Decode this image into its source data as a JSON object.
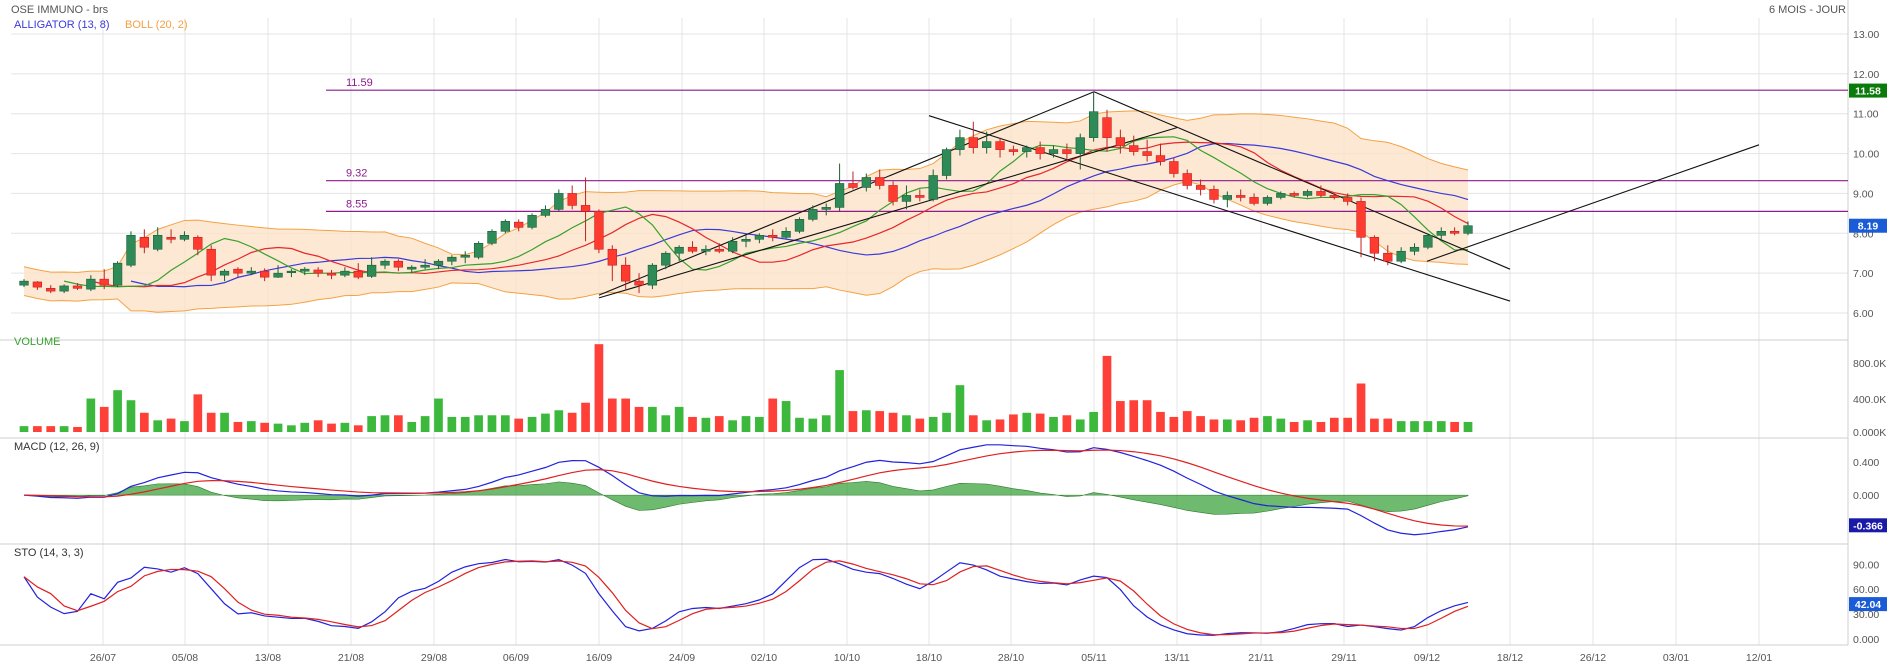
{
  "header": {
    "title": "OSE IMMUNO - brs",
    "period": "6 MOIS - JOUR",
    "legend_alligator": "ALLIGATOR (13, 8)",
    "legend_boll": "BOLL (20, 2)",
    "volume_label": "VOLUME",
    "macd_label": "MACD (12, 26, 9)",
    "sto_label": "STO (14, 3, 3)"
  },
  "colors": {
    "up": "#2e8b57",
    "down": "#ff3b30",
    "grid": "#e4e4e4",
    "boll_fill": "#fce3c8",
    "boll_line": "#f4a142",
    "alligator_blue": "#3a3adb",
    "alligator_red": "#e8262b",
    "alligator_green": "#37a12d",
    "level": "#8e1a8e",
    "macd_hist": "#3ea33e",
    "stock_last": "#1a1aa8",
    "level_badge": "#0a7b0a"
  },
  "levels": [
    {
      "label": "11.59",
      "value": 11.59
    },
    {
      "label": "9.32",
      "value": 9.32
    },
    {
      "label": "8.55",
      "value": 8.55
    }
  ],
  "badges": {
    "price_level": "11.58",
    "last_price": "8.19",
    "macd_last": "-0.366",
    "sto_last": "42.04"
  },
  "chart_data": {
    "type": "candlestick",
    "x_ticks": [
      "26/07",
      "05/08",
      "13/08",
      "21/08",
      "29/08",
      "06/09",
      "16/09",
      "24/09",
      "02/10",
      "10/10",
      "18/10",
      "28/10",
      "05/11",
      "13/11",
      "21/11",
      "29/11",
      "09/12",
      "18/12",
      "26/12",
      "03/01",
      "12/01"
    ],
    "price_axis": {
      "ticks": [
        "13.00",
        "12.00",
        "11.00",
        "10.00",
        "9.00",
        "8.00",
        "7.00",
        "6.00"
      ],
      "range": [
        5.7,
        13.3
      ]
    },
    "volume_axis": {
      "ticks": [
        "800.0K",
        "400.0K",
        "0.000K"
      ]
    },
    "macd_axis": {
      "ticks": [
        "0.400",
        "0.000",
        "-0.400"
      ]
    },
    "sto_axis": {
      "ticks": [
        "90.00",
        "60.00",
        "30.00",
        "0.000"
      ]
    },
    "candles": [
      [
        6.7,
        6.85,
        6.65,
        6.8
      ],
      [
        6.78,
        6.8,
        6.58,
        6.65
      ],
      [
        6.62,
        6.7,
        6.5,
        6.55
      ],
      [
        6.55,
        6.72,
        6.5,
        6.68
      ],
      [
        6.68,
        6.75,
        6.58,
        6.62
      ],
      [
        6.6,
        6.95,
        6.55,
        6.85
      ],
      [
        6.85,
        7.1,
        6.6,
        6.7
      ],
      [
        6.7,
        7.3,
        6.65,
        7.25
      ],
      [
        7.2,
        8.05,
        7.15,
        7.95
      ],
      [
        7.9,
        8.1,
        7.5,
        7.65
      ],
      [
        7.6,
        8.15,
        7.55,
        7.95
      ],
      [
        7.9,
        8.1,
        7.75,
        7.85
      ],
      [
        7.85,
        8.05,
        7.8,
        7.95
      ],
      [
        7.9,
        7.95,
        7.45,
        7.6
      ],
      [
        7.6,
        7.7,
        6.8,
        6.95
      ],
      [
        6.95,
        7.1,
        6.8,
        7.05
      ],
      [
        7.1,
        7.15,
        6.9,
        7.0
      ],
      [
        7.0,
        7.15,
        6.95,
        7.05
      ],
      [
        7.05,
        7.12,
        6.8,
        6.9
      ],
      [
        6.9,
        7.2,
        6.88,
        7.0
      ],
      [
        7.02,
        7.1,
        6.9,
        7.05
      ],
      [
        7.05,
        7.15,
        6.95,
        7.1
      ],
      [
        7.08,
        7.15,
        6.9,
        7.0
      ],
      [
        7.0,
        7.08,
        6.85,
        6.95
      ],
      [
        6.95,
        7.15,
        6.9,
        7.05
      ],
      [
        7.05,
        7.25,
        6.85,
        6.9
      ],
      [
        6.92,
        7.4,
        6.88,
        7.2
      ],
      [
        7.2,
        7.35,
        7.1,
        7.3
      ],
      [
        7.3,
        7.35,
        7.05,
        7.15
      ],
      [
        7.1,
        7.2,
        7.0,
        7.15
      ],
      [
        7.15,
        7.35,
        7.1,
        7.2
      ],
      [
        7.2,
        7.35,
        7.1,
        7.3
      ],
      [
        7.3,
        7.45,
        7.2,
        7.4
      ],
      [
        7.4,
        7.55,
        7.25,
        7.45
      ],
      [
        7.4,
        7.8,
        7.35,
        7.75
      ],
      [
        7.75,
        8.1,
        7.7,
        8.05
      ],
      [
        8.05,
        8.35,
        8.0,
        8.3
      ],
      [
        8.28,
        8.35,
        8.05,
        8.15
      ],
      [
        8.15,
        8.5,
        8.1,
        8.45
      ],
      [
        8.45,
        8.7,
        8.4,
        8.6
      ],
      [
        8.6,
        9.1,
        8.55,
        9.0
      ],
      [
        9.0,
        9.2,
        8.6,
        8.7
      ],
      [
        8.7,
        9.4,
        7.8,
        8.55
      ],
      [
        8.55,
        8.6,
        7.5,
        7.6
      ],
      [
        7.6,
        7.7,
        6.8,
        7.2
      ],
      [
        7.2,
        7.4,
        6.6,
        6.8
      ],
      [
        6.8,
        7.0,
        6.5,
        6.7
      ],
      [
        6.7,
        7.25,
        6.6,
        7.2
      ],
      [
        7.2,
        7.55,
        7.1,
        7.5
      ],
      [
        7.5,
        7.7,
        7.3,
        7.65
      ],
      [
        7.65,
        7.8,
        7.5,
        7.55
      ],
      [
        7.55,
        7.7,
        7.45,
        7.6
      ],
      [
        7.6,
        7.75,
        7.5,
        7.55
      ],
      [
        7.55,
        7.9,
        7.5,
        7.8
      ],
      [
        7.8,
        7.95,
        7.65,
        7.85
      ],
      [
        7.85,
        8.0,
        7.75,
        7.95
      ],
      [
        7.95,
        8.1,
        7.8,
        7.9
      ],
      [
        7.9,
        8.15,
        7.85,
        8.05
      ],
      [
        8.05,
        8.4,
        8.0,
        8.35
      ],
      [
        8.35,
        8.7,
        8.3,
        8.6
      ],
      [
        8.6,
        8.75,
        8.45,
        8.65
      ],
      [
        8.65,
        9.75,
        8.55,
        9.25
      ],
      [
        9.25,
        9.55,
        9.1,
        9.15
      ],
      [
        9.15,
        9.5,
        9.05,
        9.4
      ],
      [
        9.4,
        9.6,
        9.1,
        9.2
      ],
      [
        9.2,
        9.3,
        8.7,
        8.8
      ],
      [
        8.8,
        9.2,
        8.6,
        8.95
      ],
      [
        8.95,
        9.1,
        8.8,
        8.9
      ],
      [
        8.85,
        9.6,
        8.8,
        9.45
      ],
      [
        9.45,
        10.15,
        9.35,
        10.1
      ],
      [
        10.1,
        10.6,
        9.95,
        10.4
      ],
      [
        10.4,
        10.8,
        10.0,
        10.15
      ],
      [
        10.15,
        10.55,
        10.0,
        10.3
      ],
      [
        10.3,
        10.4,
        9.9,
        10.1
      ],
      [
        10.1,
        10.2,
        9.95,
        10.05
      ],
      [
        10.05,
        10.2,
        9.9,
        10.15
      ],
      [
        10.15,
        10.3,
        9.85,
        10.0
      ],
      [
        10.0,
        10.2,
        9.9,
        10.1
      ],
      [
        10.1,
        10.25,
        9.85,
        10.0
      ],
      [
        10.0,
        10.5,
        9.6,
        10.4
      ],
      [
        10.4,
        11.55,
        10.3,
        11.05
      ],
      [
        10.9,
        11.1,
        10.05,
        10.4
      ],
      [
        10.4,
        10.6,
        10.0,
        10.2
      ],
      [
        10.2,
        10.45,
        9.95,
        10.05
      ],
      [
        10.05,
        10.35,
        9.8,
        9.95
      ],
      [
        9.95,
        10.25,
        9.7,
        9.8
      ],
      [
        9.8,
        9.9,
        9.4,
        9.5
      ],
      [
        9.5,
        9.6,
        9.1,
        9.2
      ],
      [
        9.2,
        9.35,
        8.95,
        9.1
      ],
      [
        9.1,
        9.2,
        8.75,
        8.85
      ],
      [
        8.85,
        9.05,
        8.65,
        8.95
      ],
      [
        8.95,
        9.1,
        8.8,
        8.9
      ],
      [
        8.9,
        9.0,
        8.7,
        8.75
      ],
      [
        8.75,
        8.95,
        8.7,
        8.9
      ],
      [
        8.9,
        9.05,
        8.85,
        9.0
      ],
      [
        9.0,
        9.05,
        8.9,
        8.95
      ],
      [
        8.95,
        9.1,
        8.9,
        9.05
      ],
      [
        9.05,
        9.2,
        8.9,
        8.95
      ],
      [
        8.95,
        9.0,
        8.85,
        8.9
      ],
      [
        8.9,
        9.0,
        8.7,
        8.8
      ],
      [
        8.8,
        8.9,
        7.4,
        7.9
      ],
      [
        7.9,
        7.95,
        7.3,
        7.5
      ],
      [
        7.5,
        7.7,
        7.2,
        7.3
      ],
      [
        7.3,
        7.65,
        7.25,
        7.55
      ],
      [
        7.55,
        7.75,
        7.45,
        7.65
      ],
      [
        7.65,
        8.0,
        7.6,
        7.95
      ],
      [
        7.95,
        8.15,
        7.8,
        8.05
      ],
      [
        8.05,
        8.15,
        7.95,
        8.0
      ],
      [
        8.0,
        8.3,
        7.95,
        8.19
      ]
    ],
    "volume": [
      70,
      70,
      70,
      70,
      60,
      400,
      300,
      500,
      380,
      230,
      140,
      160,
      130,
      450,
      230,
      230,
      120,
      130,
      110,
      100,
      80,
      110,
      140,
      100,
      110,
      80,
      190,
      200,
      200,
      120,
      190,
      400,
      180,
      180,
      200,
      200,
      200,
      160,
      180,
      220,
      260,
      230,
      350,
      1050,
      400,
      400,
      300,
      300,
      200,
      300,
      180,
      170,
      190,
      140,
      190,
      180,
      400,
      370,
      170,
      160,
      200,
      740,
      250,
      260,
      250,
      230,
      200,
      160,
      180,
      230,
      560,
      200,
      140,
      150,
      210,
      230,
      220,
      180,
      200,
      150,
      240,
      910,
      370,
      380,
      380,
      240,
      180,
      250,
      190,
      150,
      150,
      140,
      170,
      190,
      160,
      120,
      140,
      120,
      170,
      170,
      580,
      160,
      160,
      130,
      130,
      130,
      130,
      120,
      120
    ],
    "macd_range": [
      -0.52,
      0.62
    ],
    "sto_range": [
      0,
      100
    ],
    "trend_lines": [
      {
        "from": [
          "16/09",
          6.45
        ],
        "to": [
          "05/11",
          11.55
        ]
      },
      {
        "from": [
          "16/09",
          6.38
        ],
        "to": [
          "13/11",
          10.65
        ]
      },
      {
        "from": [
          "05/11",
          11.55
        ],
        "to": [
          "18/12",
          7.1
        ]
      },
      {
        "from": [
          "18/10",
          10.95
        ],
        "to": [
          "18/12",
          6.3
        ]
      },
      {
        "from": [
          "09/12",
          7.3
        ],
        "to": [
          "12/01",
          10.22
        ]
      }
    ]
  }
}
